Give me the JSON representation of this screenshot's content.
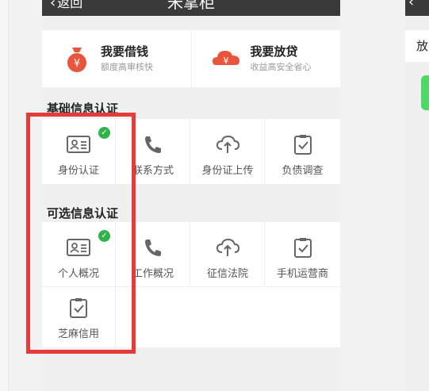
{
  "navbar": {
    "back_label": "返回",
    "title": "米掌柜",
    "more_label": "•••"
  },
  "hero": {
    "borrow": {
      "title": "我要借钱",
      "subtitle": "额度高审核快",
      "icon": "money-bag-icon",
      "color": "#e8553b"
    },
    "lend": {
      "title": "我要放贷",
      "subtitle": "收益高安全省心",
      "icon": "cloud-yen-icon",
      "color": "#e8553b"
    }
  },
  "basic": {
    "title": "基础信息认证",
    "items": [
      {
        "label": "身份认证",
        "icon": "id-card-icon",
        "verified": true
      },
      {
        "label": "联系方式",
        "icon": "phone-icon",
        "verified": false
      },
      {
        "label": "身份证上传",
        "icon": "cloud-upload-icon",
        "verified": false
      },
      {
        "label": "负债调查",
        "icon": "clipboard-check-icon",
        "verified": false
      }
    ]
  },
  "optional": {
    "title": "可选信息认证",
    "items": [
      {
        "label": "个人概况",
        "icon": "id-card-icon",
        "verified": true
      },
      {
        "label": "工作概况",
        "icon": "phone-icon",
        "verified": false
      },
      {
        "label": "征信法院",
        "icon": "cloud-upload-icon",
        "verified": false
      },
      {
        "label": "手机运营商",
        "icon": "clipboard-check-icon",
        "verified": false
      },
      {
        "label": "芝麻信用",
        "icon": "clipboard-check-icon",
        "verified": false
      }
    ]
  },
  "right_panel": {
    "row_text": "放"
  },
  "colors": {
    "check_green": "#2fb34a",
    "highlight_red": "#e63b3b",
    "navbar": "#3a3a3a"
  }
}
